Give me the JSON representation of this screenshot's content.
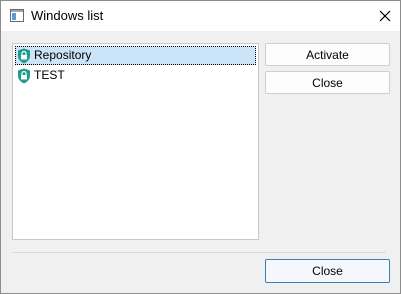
{
  "window": {
    "title": "Windows list",
    "title_icon": "window-icon",
    "close_icon": "close-icon"
  },
  "list": {
    "items": [
      {
        "label": "Repository",
        "icon": "shield-lock-icon",
        "selected": true
      },
      {
        "label": "TEST",
        "icon": "shield-lock-icon",
        "selected": false
      }
    ]
  },
  "actions": {
    "activate_label": "Activate",
    "close_label": "Close"
  },
  "footer": {
    "close_label": "Close"
  },
  "colors": {
    "selection": "#cce4f7",
    "shield_teal": "#1e9c8c",
    "default_button_border": "#3c7fb1"
  }
}
